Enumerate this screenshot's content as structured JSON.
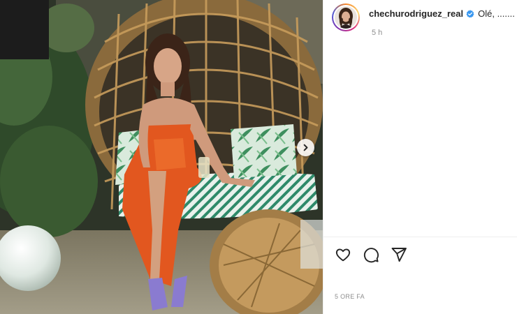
{
  "post": {
    "username": "chechurodriguez_real",
    "caption": "Olé, .......",
    "time_ago": "5 h",
    "timestamp": "5 ORE FA",
    "verified": true
  },
  "media": {
    "photo": "woman in orange dress sitting on rattan egg chair",
    "next_icon": "chevron-right-icon"
  },
  "actions": {
    "like_icon": "heart-icon",
    "comment_icon": "comment-icon",
    "share_icon": "paper-plane-icon"
  },
  "colors": {
    "verified_badge": "#3897f0",
    "text_primary": "#262626",
    "text_secondary": "#8e8e8e",
    "divider": "#efefef"
  }
}
